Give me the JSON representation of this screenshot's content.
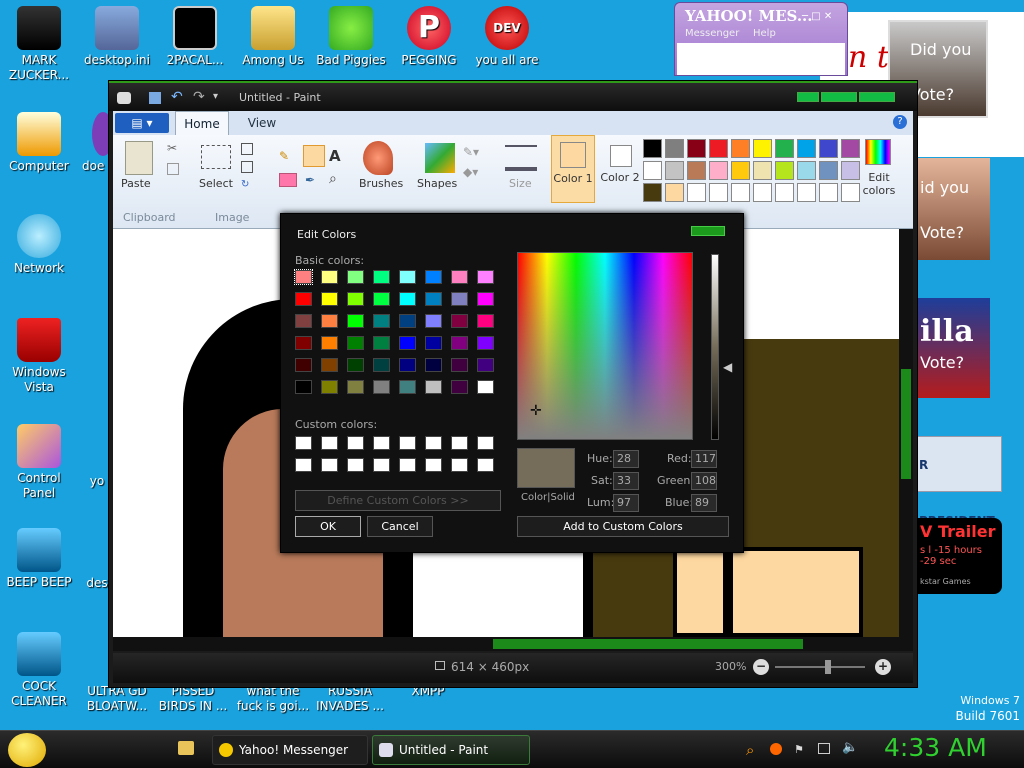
{
  "desktop": {
    "icons": [
      {
        "label": "MARK ZUCKER..."
      },
      {
        "label": "desktop.ini"
      },
      {
        "label": "2PACAL..."
      },
      {
        "label": "Among Us"
      },
      {
        "label": "Bad Piggies"
      },
      {
        "label": "PEGGING"
      },
      {
        "label": "you all are"
      },
      {
        "label": "Computer"
      },
      {
        "label": "doe"
      },
      {
        "label": "Network"
      },
      {
        "label": "Windows Vista"
      },
      {
        "label": "Control Panel"
      },
      {
        "label": "yo"
      },
      {
        "label": "BEEP BEEP"
      },
      {
        "label": "des"
      },
      {
        "label": "COCK CLEANER"
      },
      {
        "label": "ULTRA GD BLOATW..."
      },
      {
        "label": "PISSED BIRDS IN ..."
      },
      {
        "label": "what the fuck is goi..."
      },
      {
        "label": "RUSSIA INVADES ..."
      },
      {
        "label": "XMPP"
      }
    ],
    "watermark_line1": "Windows 7",
    "watermark_line2": "Build 7601",
    "collage": {
      "caption1": "Did you",
      "caption2": "Vote?",
      "caption3": "id you",
      "caption4": "Vote?",
      "caption5": "illa",
      "caption6": "Vote?",
      "president": "R PRESIDENT",
      "trailer": "V Trailer",
      "trailer_sub": "s l -15 hours",
      "trailer_sub2": "-29 sec",
      "trailer_brand": "kstar Games",
      "big_n": "n t"
    }
  },
  "yahoo": {
    "title": "YAHOO! MES...",
    "menu1": "Messenger",
    "menu2": "Help"
  },
  "paint": {
    "title": "Untitled - Paint",
    "tabs": [
      "Home",
      "View"
    ],
    "groups": {
      "clipboard": "Clipboard",
      "image": "Image",
      "paste": "Paste",
      "select": "Select",
      "brushes": "Brushes",
      "shapes": "Shapes",
      "size": "Size",
      "color1": "Color 1",
      "color2": "Color 2",
      "edit_colors": "Edit colors"
    },
    "palette_row1": [
      "#000000",
      "#7f7f7f",
      "#880015",
      "#ed1c24",
      "#ff7f27",
      "#fff200",
      "#22b14c",
      "#00a2e8",
      "#3f48cc",
      "#a349a4"
    ],
    "palette_row2": [
      "#ffffff",
      "#c3c3c3",
      "#b97a57",
      "#ffaec9",
      "#ffc90e",
      "#efe4b0",
      "#b5e61d",
      "#99d9ea",
      "#7092be",
      "#c8bfe7"
    ],
    "palette_row3": [
      "#473a0f",
      "#fdd8a0",
      "#ffffff",
      "#ffffff",
      "#ffffff",
      "#ffffff",
      "#ffffff",
      "#ffffff",
      "#ffffff",
      "#ffffff"
    ],
    "status_size": "614 × 460px",
    "zoom": "300%"
  },
  "dialog": {
    "title": "Edit Colors",
    "basic_label": "Basic colors:",
    "custom_label": "Custom colors:",
    "define_btn": "Define Custom Colors >>",
    "ok": "OK",
    "cancel": "Cancel",
    "add_btn": "Add to Custom Colors",
    "colorsolid": "Color|Solid",
    "hue_label": "Hue:",
    "hue": "28",
    "sat_label": "Sat:",
    "sat": "33",
    "lum_label": "Lum:",
    "lum": "97",
    "red_label": "Red:",
    "red": "117",
    "green_label": "Green:",
    "green": "108",
    "blue_label": "Blue:",
    "blue": "89",
    "basic_colors": [
      "#ff8080",
      "#ffff80",
      "#80ff80",
      "#00ff80",
      "#80ffff",
      "#0080ff",
      "#ff80c0",
      "#ff80ff",
      "#ff0000",
      "#ffff00",
      "#80ff00",
      "#00ff40",
      "#00ffff",
      "#0080c0",
      "#8080c0",
      "#ff00ff",
      "#804040",
      "#ff8040",
      "#00ff00",
      "#008080",
      "#004080",
      "#8080ff",
      "#800040",
      "#ff0080",
      "#800000",
      "#ff8000",
      "#008000",
      "#008040",
      "#0000ff",
      "#0000a0",
      "#800080",
      "#8000ff",
      "#400000",
      "#804000",
      "#004000",
      "#004040",
      "#000080",
      "#000040",
      "#400040",
      "#400080",
      "#000000",
      "#808000",
      "#808040",
      "#808080",
      "#408080",
      "#c0c0c0",
      "#400040",
      "#ffffff"
    ]
  },
  "taskbar": {
    "items": [
      "Yahoo! Messenger",
      "Untitled - Paint"
    ],
    "clock": "4:33 AM"
  }
}
